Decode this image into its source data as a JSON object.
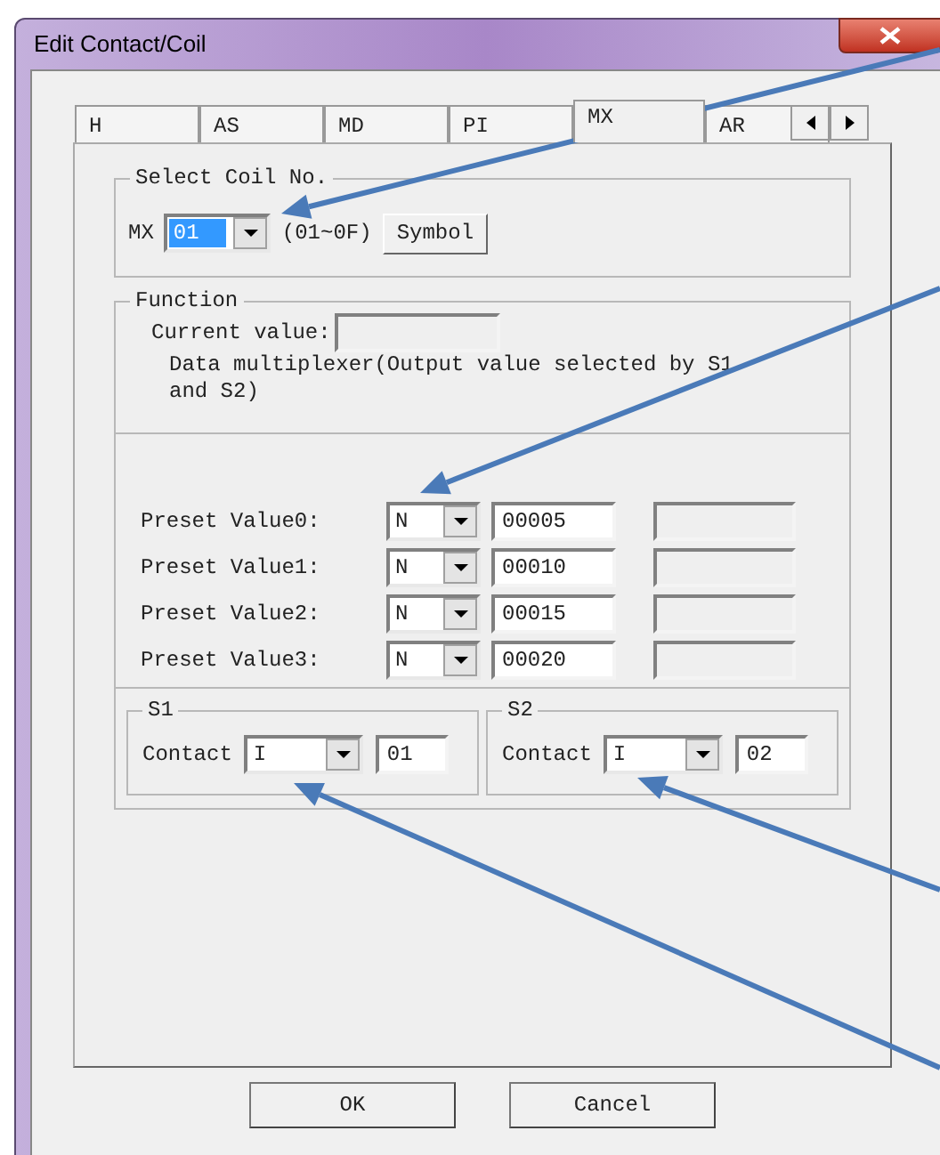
{
  "window": {
    "title": "Edit Contact/Coil"
  },
  "tabs": [
    {
      "label": "H",
      "selected": false
    },
    {
      "label": "AS",
      "selected": false
    },
    {
      "label": "MD",
      "selected": false
    },
    {
      "label": "PI",
      "selected": false
    },
    {
      "label": "MX",
      "selected": true
    },
    {
      "label": "AR",
      "selected": false
    }
  ],
  "select_coil": {
    "title": "Select Coil No.",
    "label": "MX",
    "value": "01",
    "highlighted": true,
    "range": "(01~0F)",
    "button": "Symbol"
  },
  "function": {
    "title": "Function",
    "current_value_label": "Current value:",
    "description": "Data multiplexer(Output value selected by S1 and S2)"
  },
  "presets": [
    {
      "label": "Preset Value0:",
      "type": "N",
      "value": "00005"
    },
    {
      "label": "Preset Value1:",
      "type": "N",
      "value": "00010"
    },
    {
      "label": "Preset Value2:",
      "type": "N",
      "value": "00015"
    },
    {
      "label": "Preset Value3:",
      "type": "N",
      "value": "00020"
    }
  ],
  "sources": [
    {
      "title": "S1",
      "label": "Contact",
      "type": "I",
      "value": "01"
    },
    {
      "title": "S2",
      "label": "Contact",
      "type": "I",
      "value": "02"
    }
  ],
  "buttons": [
    "OK",
    "Cancel"
  ]
}
